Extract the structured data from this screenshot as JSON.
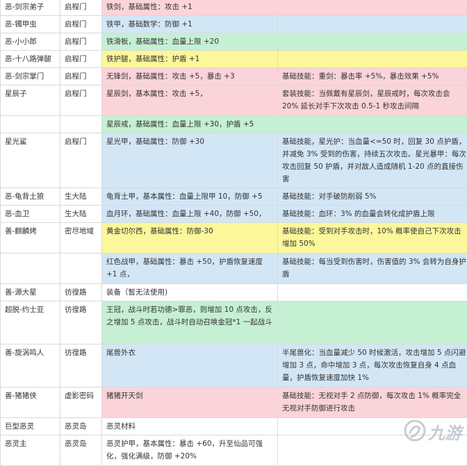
{
  "rows": [
    {
      "name": "恶-剑宗弟子",
      "place": "启程门",
      "item": "铁剑，基础属性：攻击 +1",
      "skill": ""
    },
    {
      "name": "恶-镯甲虫",
      "place": "启程门",
      "item": "铁甲，基础数学：防御 +1",
      "skill": ""
    },
    {
      "name": "恶-小小郎",
      "place": "启程门",
      "item": "铁滑板，基础属性：血量上限 +20",
      "skill": ""
    },
    {
      "name": "恶-十八路弹腿",
      "place": "启程门",
      "item": "铁护腿，基础属性：护盾 +1",
      "skill": ""
    },
    {
      "name": "恶-剑宗掌门",
      "place": "启程门",
      "item": "无锋剑，基础属性：攻击 +5，暴击 +3",
      "skill": "基础技能：重剑：暴击率 +5%，暴击效果 +5%"
    },
    {
      "name": "星辰子",
      "place": "启程门",
      "item": "星辰剑，基本属性：攻击 +5，",
      "skill": "套装技能：当佩戴有星辰剑，星辰戒时，每次攻击会 20% 延长对手下次攻击 0.5-1 秒攻击间隔"
    },
    {
      "name": "",
      "place": "",
      "item": "星辰戒，基础属性：血量上限 +30，护盾 +5",
      "skill": ""
    },
    {
      "name": "星光鲨",
      "place": "启程门",
      "item": "星光甲，基础属性：防御 +30",
      "skill": "基础技能，星光护：当血量<=50 时，回复 30 点护盾，并减免 3% 受到的伤害，持续五次攻击。星光暴甲：每次攻击回复 50 护盾，并对敌人造成随机 1-20 点的直接伤害"
    },
    {
      "name": "恶-龟背土狼",
      "place": "生大陆",
      "item": "龟背土甲，基本属性：血量上限甲 10，防御 +5",
      "skill": "基础技能：对手破防削弱 5%"
    },
    {
      "name": "恶-血卫",
      "place": "生大陆",
      "item": "血月环，基础属性：血量上限 +40，防御 +50，",
      "skill": "基础技能：血环：3% 的血量会转化成护盾上限"
    },
    {
      "name": "善-麒麟烤",
      "place": "密尽地域",
      "item": "黄金切尔西，基础属性：防御-30",
      "skill": "基础技能：受到对手攻击时，10% 概率使自己下次攻击增加 50%"
    },
    {
      "name": "",
      "place": "",
      "item": "红色战甲，基础属性：暴击 +50，护盾恢复速度 +1 点，",
      "skill": "基础技能：每当受到伤害时，伤害值的 3% 会转为自身护盾"
    },
    {
      "name": "善-源大星",
      "place": "彷徨路",
      "item": "装备（暂无法使用)",
      "skill": ""
    },
    {
      "name": "超脱-约士亚",
      "place": "彷徨路",
      "item": "王冠，战斗时若功德>罪恶，则增加 10 点攻击，反之增加 5 点攻击，战斗时自动召唤金冠*1 一起战斗",
      "skill": ""
    },
    {
      "name": "善-旋涡鸣人",
      "place": "彷徨路",
      "item": "尾兽外衣",
      "skill": "半尾兽化：当血量减少 50 时候激活，攻击增加 5 点闪避增加 3 点，命中增加 3 点，每次攻击恢复自身 4 点血量，护盾恢复速度加快 1%"
    },
    {
      "name": "善-猪猪侠",
      "place": "虚影密码",
      "item": "猪猪开天剑",
      "skill": "基础技能：无视对手 2 点防御，每次攻击 1% 概率完全无视对手防御进行攻击"
    },
    {
      "name": "巨型恶灵",
      "place": "恶灵岛",
      "item": "恶灵材料",
      "skill": ""
    },
    {
      "name": "恶灵主",
      "place": "恶灵岛",
      "item": "恶灵护甲，基本属性：暴击 +60，升至仙品可强化，强化满级，防御 +20%",
      "skill": ""
    }
  ],
  "watermark": {
    "text": "九游",
    "icon": "jiuyou-logo-icon"
  },
  "colors": {
    "pink": "#fad4d9",
    "blue": "#d3e6f5",
    "green": "#c5f0d3",
    "yellow": "#fbf79a"
  }
}
